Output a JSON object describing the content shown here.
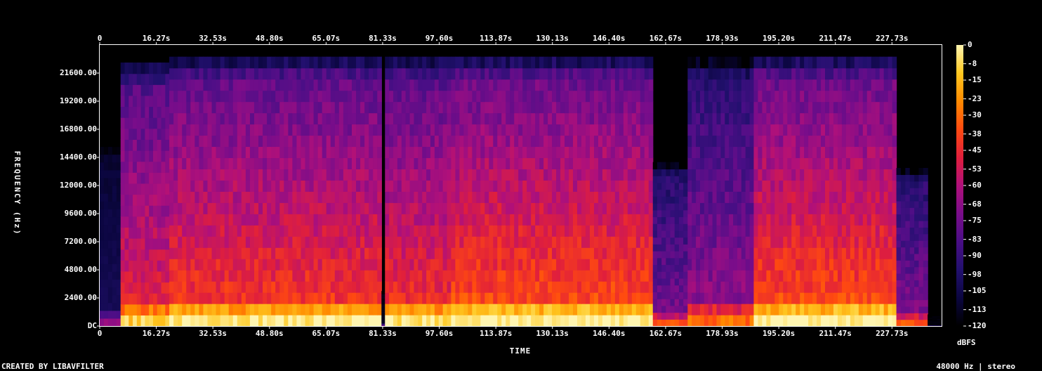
{
  "chart_data": {
    "type": "heatmap",
    "title": "",
    "xlabel": "TIME",
    "ylabel": "FREQUENCY (Hz)",
    "x_unit": "s",
    "y_unit": "Hz",
    "xlim": [
      0,
      242
    ],
    "ylim": [
      0,
      24000
    ],
    "x_ticks": [
      "0",
      "16.27s",
      "32.53s",
      "48.80s",
      "65.07s",
      "81.33s",
      "97.60s",
      "113.87s",
      "130.13s",
      "146.40s",
      "162.67s",
      "178.93s",
      "195.20s",
      "211.47s",
      "227.73s"
    ],
    "x_tick_values": [
      0,
      16.27,
      32.53,
      48.8,
      65.07,
      81.33,
      97.6,
      113.87,
      130.13,
      146.4,
      162.67,
      178.93,
      195.2,
      211.47,
      227.73
    ],
    "y_ticks": [
      "DC",
      "2400.00",
      "4800.00",
      "7200.00",
      "9600.00",
      "12000.00",
      "14400.00",
      "16800.00",
      "19200.00",
      "21600.00"
    ],
    "y_tick_values": [
      0,
      2400,
      4800,
      7200,
      9600,
      12000,
      14400,
      16800,
      19200,
      21600
    ],
    "colorbar": {
      "unit": "dBFS",
      "range": [
        -120,
        0
      ],
      "ticks": [
        "0",
        "-8",
        "-15",
        "-23",
        "-30",
        "-38",
        "-45",
        "-53",
        "-60",
        "-68",
        "-75",
        "-83",
        "-90",
        "-98",
        "-105",
        "-113",
        "-120"
      ],
      "colors": [
        "#000000",
        "#0b0640",
        "#22106e",
        "#4a0e86",
        "#7a0d8a",
        "#b0107a",
        "#e01f3c",
        "#ff4a10",
        "#ff8a00",
        "#ffc820",
        "#fff5b0"
      ]
    },
    "segments": [
      {
        "t": [
          0,
          6
        ],
        "level": 0.15,
        "cutoff_hz": 16000
      },
      {
        "t": [
          6,
          20
        ],
        "level": 0.62,
        "cutoff_hz": 22500
      },
      {
        "t": [
          20,
          81
        ],
        "level": 0.68,
        "cutoff_hz": 23000
      },
      {
        "t": [
          81,
          82
        ],
        "level": 0.05,
        "cutoff_hz": 3000
      },
      {
        "t": [
          82,
          101
        ],
        "level": 0.66,
        "cutoff_hz": 23000
      },
      {
        "t": [
          101,
          159
        ],
        "level": 0.72,
        "cutoff_hz": 23000
      },
      {
        "t": [
          159,
          169
        ],
        "level": 0.4,
        "cutoff_hz": 14000
      },
      {
        "t": [
          169,
          188
        ],
        "level": 0.45,
        "cutoff_hz": 23000
      },
      {
        "t": [
          188,
          229
        ],
        "level": 0.72,
        "cutoff_hz": 23000
      },
      {
        "t": [
          229,
          238
        ],
        "level": 0.42,
        "cutoff_hz": 13500
      },
      {
        "t": [
          238,
          242
        ],
        "level": 0.02,
        "cutoff_hz": 1000
      }
    ]
  },
  "footer": {
    "left": "CREATED BY LIBAVFILTER",
    "right": "48000 Hz | stereo"
  }
}
